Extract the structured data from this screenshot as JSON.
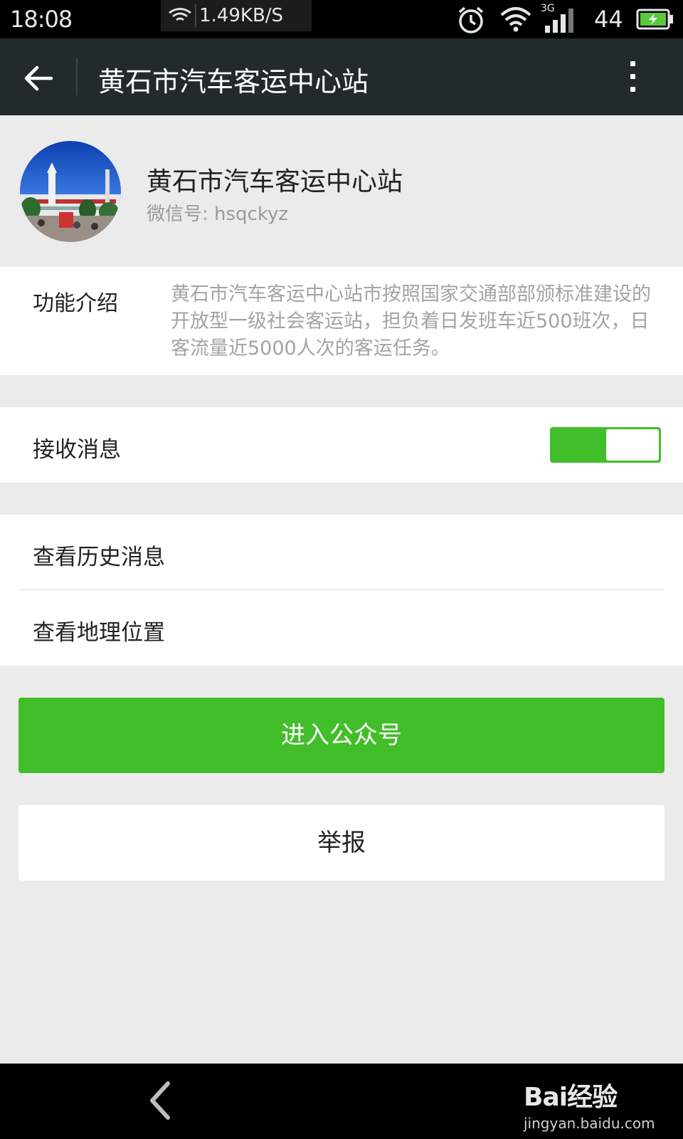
{
  "status_bar": {
    "time": "18:08",
    "net_speed": "1.49KB/S",
    "network_type": "3G",
    "battery_level": "44"
  },
  "header": {
    "title": "黄石市汽车客运中心站"
  },
  "profile": {
    "name": "黄石市汽车客运中心站",
    "wechat_id_label": "微信号:",
    "wechat_id": " hsqckyz"
  },
  "intro": {
    "label": "功能介绍",
    "text": "黄石市汽车客运中心站市按照国家交通部部颁标准建设的开放型一级社会客运站，担负着日发班车近500班次，日客流量近5000人次的客运任务。"
  },
  "receive_messages": {
    "label": "接收消息",
    "enabled": true
  },
  "links": {
    "history": "查看历史消息",
    "location": "查看地理位置"
  },
  "buttons": {
    "enter": "进入公众号",
    "report": "举报"
  },
  "watermark": {
    "brand": "Bai经验",
    "url": "jingyan.baidu.com"
  },
  "colors": {
    "accent_green": "#43be2b",
    "titlebar_bg": "#232a2e",
    "page_bg": "#ebebeb"
  }
}
